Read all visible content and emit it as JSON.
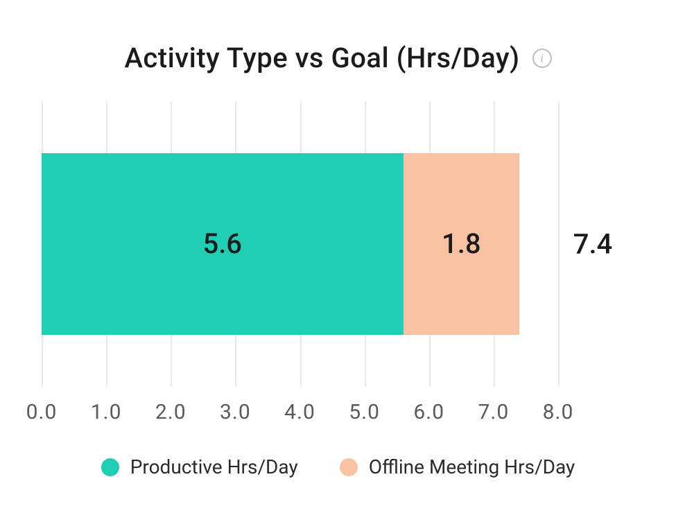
{
  "title": "Activity Type vs Goal (Hrs/Day)",
  "info_icon_glyph": "i",
  "total_label": "7.4",
  "legend": {
    "productive": "Productive Hrs/Day",
    "offline": "Offline Meeting Hrs/Day"
  },
  "chart_data": {
    "type": "bar",
    "orientation": "horizontal",
    "stacked": true,
    "title": "Activity Type vs Goal (Hrs/Day)",
    "xlabel": "",
    "ylabel": "",
    "xlim": [
      0.0,
      8.0
    ],
    "ticks": [
      "0.0",
      "1.0",
      "2.0",
      "3.0",
      "4.0",
      "5.0",
      "6.0",
      "7.0",
      "8.0"
    ],
    "categories": [
      ""
    ],
    "series": [
      {
        "name": "Productive Hrs/Day",
        "values": [
          5.6
        ],
        "color": "#1fceb3"
      },
      {
        "name": "Offline Meeting Hrs/Day",
        "values": [
          1.8
        ],
        "color": "#f9c2a3"
      }
    ],
    "total": 7.4
  }
}
